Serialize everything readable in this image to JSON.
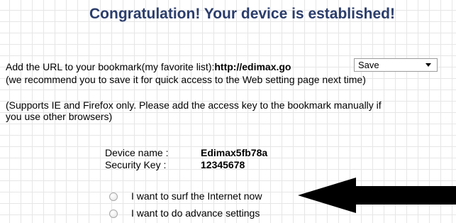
{
  "title": "Congratulation! Your device is established!",
  "bookmark": {
    "prefix": "Add the URL to your bookmark(my favorite list):",
    "url": "http://edimax.go",
    "select_value": "Save",
    "recommend": "(we recommend you to save it for quick access to the Web setting page next time)"
  },
  "browser_note": {
    "line1": "(Supports IE and Firefox only. Please add the access key to the bookmark manually if",
    "line2": "you use other browsers)"
  },
  "device": {
    "name_label": "Device name :",
    "name_value": "Edimax5fb78a",
    "key_label": "Security Key :",
    "key_value": "12345678"
  },
  "options": [
    {
      "label": "I want to surf the Internet now"
    },
    {
      "label": "I want to do advance settings"
    }
  ]
}
